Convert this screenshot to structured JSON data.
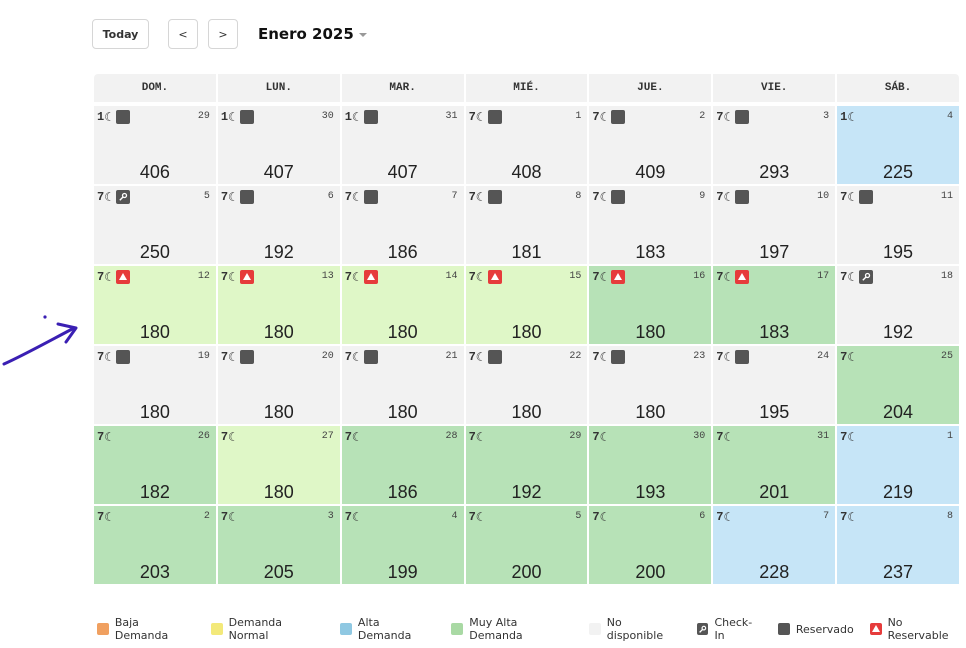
{
  "toolbar": {
    "today_label": "Today",
    "prev_label": "<",
    "next_label": ">",
    "month_label": "Enero 2025"
  },
  "colors": {
    "no_disponible": "#f2f2f2",
    "demanda_normal": "#dff7c7",
    "muy_alta": "#b7e2b7",
    "alta": "#c6e5f7",
    "badge_dark": "#555555",
    "badge_red": "#e63b3b",
    "arrow": "#3a1fb3"
  },
  "weekdays": [
    "DOM.",
    "LUN.",
    "MAR.",
    "MIÉ.",
    "JUE.",
    "VIE.",
    "SÁB."
  ],
  "moon_glyph": "☾",
  "days": [
    {
      "day": "29",
      "nights": "1",
      "price": "406",
      "status": "none",
      "badge": "reserved"
    },
    {
      "day": "30",
      "nights": "1",
      "price": "407",
      "status": "none",
      "badge": "reserved"
    },
    {
      "day": "31",
      "nights": "1",
      "price": "407",
      "status": "none",
      "badge": "reserved"
    },
    {
      "day": "1",
      "nights": "7",
      "price": "408",
      "status": "none",
      "badge": "reserved"
    },
    {
      "day": "2",
      "nights": "7",
      "price": "409",
      "status": "none",
      "badge": "reserved"
    },
    {
      "day": "3",
      "nights": "7",
      "price": "293",
      "status": "none",
      "badge": "reserved"
    },
    {
      "day": "4",
      "nights": "1",
      "price": "225",
      "status": "alta",
      "badge": ""
    },
    {
      "day": "5",
      "nights": "7",
      "price": "250",
      "status": "none",
      "badge": "checkin"
    },
    {
      "day": "6",
      "nights": "7",
      "price": "192",
      "status": "none",
      "badge": "reserved"
    },
    {
      "day": "7",
      "nights": "7",
      "price": "186",
      "status": "none",
      "badge": "reserved"
    },
    {
      "day": "8",
      "nights": "7",
      "price": "181",
      "status": "none",
      "badge": "reserved"
    },
    {
      "day": "9",
      "nights": "7",
      "price": "183",
      "status": "none",
      "badge": "reserved"
    },
    {
      "day": "10",
      "nights": "7",
      "price": "197",
      "status": "none",
      "badge": "reserved"
    },
    {
      "day": "11",
      "nights": "7",
      "price": "195",
      "status": "none",
      "badge": "reserved"
    },
    {
      "day": "12",
      "nights": "7",
      "price": "180",
      "status": "normal",
      "badge": "noreserv"
    },
    {
      "day": "13",
      "nights": "7",
      "price": "180",
      "status": "normal",
      "badge": "noreserv"
    },
    {
      "day": "14",
      "nights": "7",
      "price": "180",
      "status": "normal",
      "badge": "noreserv"
    },
    {
      "day": "15",
      "nights": "7",
      "price": "180",
      "status": "normal",
      "badge": "noreserv"
    },
    {
      "day": "16",
      "nights": "7",
      "price": "180",
      "status": "muy",
      "badge": "noreserv"
    },
    {
      "day": "17",
      "nights": "7",
      "price": "183",
      "status": "muy",
      "badge": "noreserv"
    },
    {
      "day": "18",
      "nights": "7",
      "price": "192",
      "status": "none",
      "badge": "checkin"
    },
    {
      "day": "19",
      "nights": "7",
      "price": "180",
      "status": "none",
      "badge": "reserved"
    },
    {
      "day": "20",
      "nights": "7",
      "price": "180",
      "status": "none",
      "badge": "reserved"
    },
    {
      "day": "21",
      "nights": "7",
      "price": "180",
      "status": "none",
      "badge": "reserved"
    },
    {
      "day": "22",
      "nights": "7",
      "price": "180",
      "status": "none",
      "badge": "reserved"
    },
    {
      "day": "23",
      "nights": "7",
      "price": "180",
      "status": "none",
      "badge": "reserved"
    },
    {
      "day": "24",
      "nights": "7",
      "price": "195",
      "status": "none",
      "badge": "reserved"
    },
    {
      "day": "25",
      "nights": "7",
      "price": "204",
      "status": "muy",
      "badge": ""
    },
    {
      "day": "26",
      "nights": "7",
      "price": "182",
      "status": "muy",
      "badge": ""
    },
    {
      "day": "27",
      "nights": "7",
      "price": "180",
      "status": "normal",
      "badge": ""
    },
    {
      "day": "28",
      "nights": "7",
      "price": "186",
      "status": "muy",
      "badge": ""
    },
    {
      "day": "29",
      "nights": "7",
      "price": "192",
      "status": "muy",
      "badge": ""
    },
    {
      "day": "30",
      "nights": "7",
      "price": "193",
      "status": "muy",
      "badge": ""
    },
    {
      "day": "31",
      "nights": "7",
      "price": "201",
      "status": "muy",
      "badge": ""
    },
    {
      "day": "1",
      "nights": "7",
      "price": "219",
      "status": "alta",
      "badge": ""
    },
    {
      "day": "2",
      "nights": "7",
      "price": "203",
      "status": "muy",
      "badge": ""
    },
    {
      "day": "3",
      "nights": "7",
      "price": "205",
      "status": "muy",
      "badge": ""
    },
    {
      "day": "4",
      "nights": "7",
      "price": "199",
      "status": "muy",
      "badge": ""
    },
    {
      "day": "5",
      "nights": "7",
      "price": "200",
      "status": "muy",
      "badge": ""
    },
    {
      "day": "6",
      "nights": "7",
      "price": "200",
      "status": "muy",
      "badge": ""
    },
    {
      "day": "7",
      "nights": "7",
      "price": "228",
      "status": "alta",
      "badge": ""
    },
    {
      "day": "8",
      "nights": "7",
      "price": "237",
      "status": "alta",
      "badge": ""
    }
  ],
  "legend": [
    {
      "label": "Baja Demanda",
      "color": "#f0a060",
      "icon": ""
    },
    {
      "label": "Demanda Normal",
      "color": "#f3e97a",
      "icon": ""
    },
    {
      "label": "Alta Demanda",
      "color": "#8fc8e2",
      "icon": ""
    },
    {
      "label": "Muy Alta Demanda",
      "color": "#a9d9a4",
      "icon": ""
    },
    {
      "label": "No disponible",
      "color": "#f2f2f2",
      "icon": ""
    },
    {
      "label": "Check-In",
      "color": "#555555",
      "icon": "key-icon"
    },
    {
      "label": "Reservado",
      "color": "#555555",
      "icon": ""
    },
    {
      "label": "No Reservable",
      "color": "#e63b3b",
      "icon": "warning-icon"
    }
  ]
}
